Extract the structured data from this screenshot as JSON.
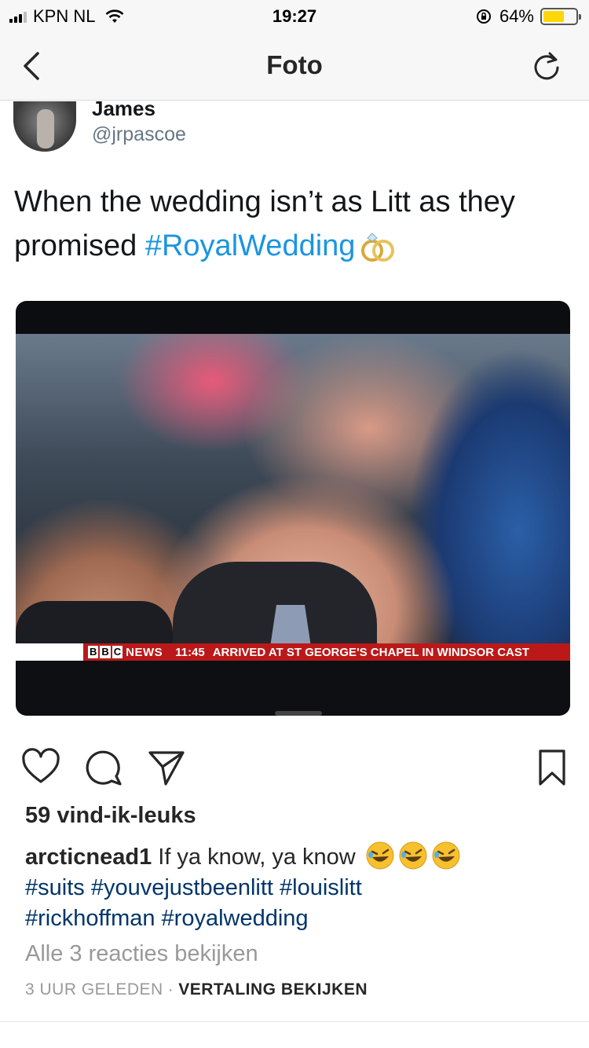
{
  "status_bar": {
    "carrier": "KPN NL",
    "time": "19:27",
    "battery_percent": "64%",
    "battery_level": 0.64,
    "battery_color": "#ffd60a"
  },
  "nav": {
    "title": "Foto",
    "back_icon": "chevron-left-icon",
    "refresh_icon": "refresh-icon"
  },
  "tweet": {
    "name": "James",
    "handle": "@jrpascoe",
    "text": "When the wedding isn’t as Litt as they promised ",
    "hashtag": "#RoyalWedding",
    "hashtag_color": "#1b95e0",
    "tv_ticker": {
      "bbc_letters": [
        "B",
        "B",
        "C"
      ],
      "news": "NEWS",
      "time": "11:45",
      "message": "ARRIVED AT ST GEORGE'S CHAPEL IN WINDSOR CAST"
    }
  },
  "actions": {
    "like_icon": "heart-icon",
    "comment_icon": "comment-icon",
    "share_icon": "share-icon",
    "save_icon": "bookmark-icon"
  },
  "post": {
    "likes": "59 vind-ik-leuks",
    "caption_user": "arcticnead1",
    "caption_text": " If ya know, ya know ",
    "hashtags_line1": "#suits #youvejustbeenlitt #louislitt",
    "hashtags_line2": "#rickhoffman #royalwedding",
    "hashtag_color": "#003569",
    "view_comments": "Alle 3 reacties bekijken",
    "time_ago": "3 UUR GELEDEN",
    "separator": "·",
    "translate": "VERTALING BEKIJKEN"
  }
}
